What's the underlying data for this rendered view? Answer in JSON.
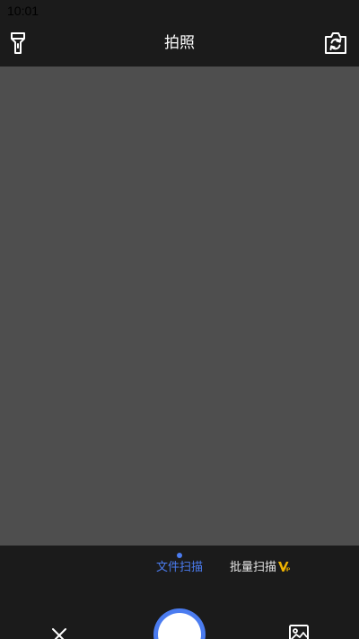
{
  "status_bar": {
    "time": "10:01"
  },
  "header": {
    "title": "拍照",
    "flash_icon": "flashlight-icon",
    "switch_icon": "camera-switch-icon"
  },
  "mode_tabs": {
    "active": "文件扫描",
    "items": [
      {
        "label": "文件扫描",
        "selected": true
      },
      {
        "label": "批量扫描",
        "badge": "VIP",
        "selected": false
      }
    ]
  },
  "bottom_controls": {
    "close_icon": "close-icon",
    "shutter": "shutter-button",
    "gallery_icon": "gallery-icon"
  },
  "colors": {
    "accent": "#4b7cf0",
    "background": "#1b1b1b",
    "viewfinder": "#4e4e4e",
    "vip": "#f0b400"
  }
}
